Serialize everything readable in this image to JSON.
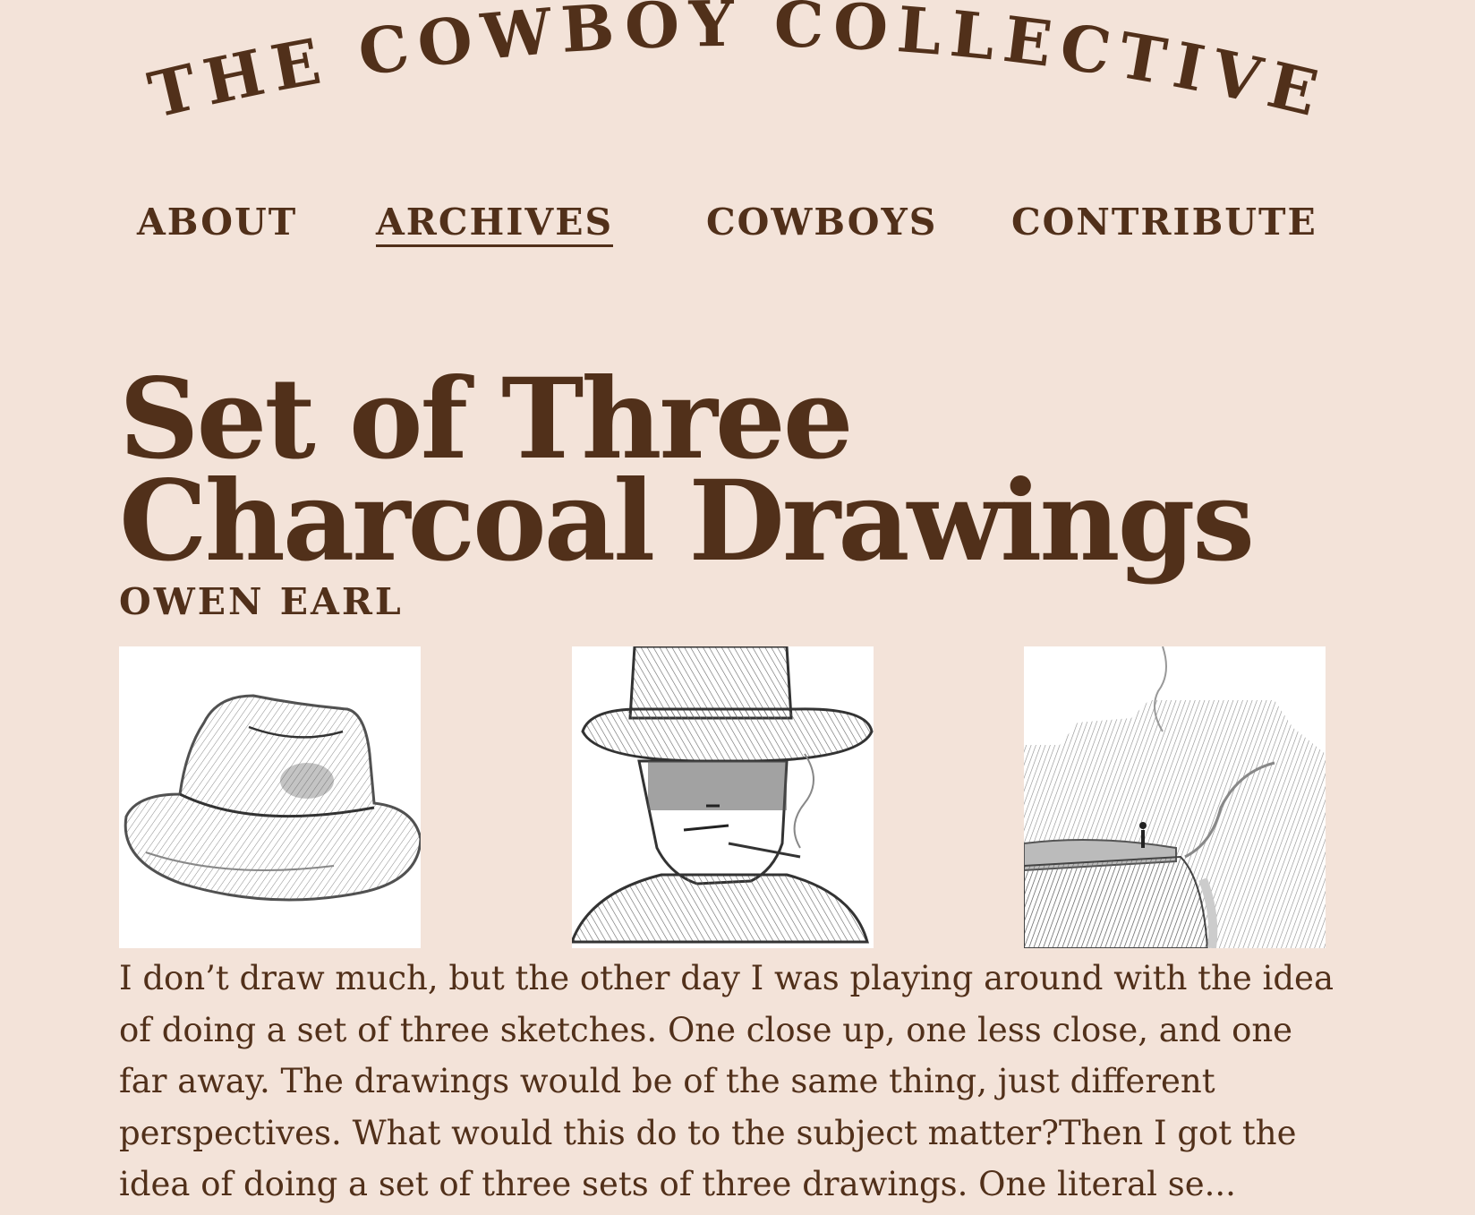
{
  "site": {
    "title": "THE COWBOY COLLECTIVE"
  },
  "nav": {
    "items": [
      {
        "label": "ABOUT"
      },
      {
        "label": "ARCHIVES"
      },
      {
        "label": "COWBOYS"
      },
      {
        "label": "CONTRIBUTE"
      }
    ],
    "active": "ARCHIVES"
  },
  "article": {
    "title_line1": "Set of Three",
    "title_line2": "Charcoal Drawings",
    "author": "OWEN EARL",
    "excerpt": "I don’t draw much, but the other day I was playing around with the idea of doing a set of three sketches. One close up, one less close, and one far away. The drawings would be of the same thing, just different perspectives. What would this do to the subject matter?Then I got the idea of doing a set of three sets of three drawings. One literal se...",
    "images": [
      {
        "subject": "cowboy-hat"
      },
      {
        "subject": "cowboy-portrait"
      },
      {
        "subject": "canyon-landscape"
      }
    ]
  },
  "colors": {
    "background": "#f3e3d9",
    "text": "#51301a",
    "image_background": "#ffffff"
  }
}
